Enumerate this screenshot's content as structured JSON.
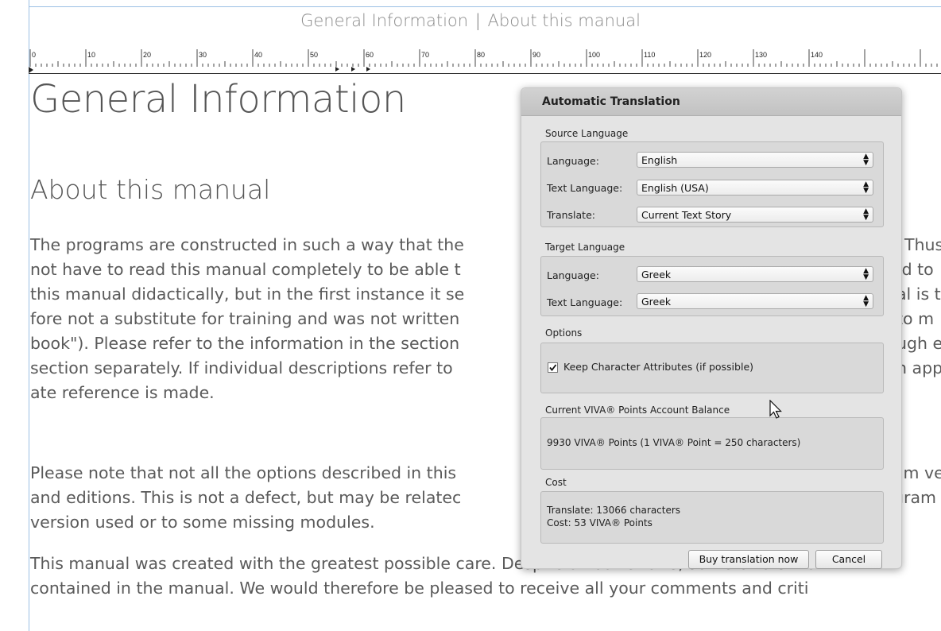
{
  "header": {
    "section": "General Information",
    "separator": "|",
    "topic": "About this manual"
  },
  "ruler": {
    "labels": [
      "0",
      "10",
      "20",
      "30",
      "40",
      "50",
      "60",
      "70",
      "80",
      "90",
      "100",
      "110",
      "120",
      "130",
      "140"
    ]
  },
  "document": {
    "heading1": "General Information",
    "heading2": "About this manual",
    "para1_lines": [
      "The programs are constructed in such a way that the",
      "not have to read this manual completely to be able t",
      "this manual didactically, but in the first instance it se",
      "fore not a substitute for training and was not written",
      "book\"). Please refer to the information in the section",
      "section separately. If individual descriptions refer to",
      "ate reference is made."
    ],
    "para1_right": [
      "Thus",
      "ed to",
      "al is t",
      "to m",
      "ugh e",
      "n app"
    ],
    "para2_lines": [
      "Please note that not all the options described in this",
      "and editions. This is not a defect, but may be relatec",
      "version used or to some missing modules."
    ],
    "para2_right": [
      "am ve",
      "gram"
    ],
    "para3_lines": [
      "This manual was created with the greatest possible care. Despite all our efforts, some errors ma",
      "contained in the manual. We would therefore be pleased to receive all your comments and criti"
    ]
  },
  "dialog": {
    "title": "Automatic Translation",
    "source_section": "Source Language",
    "source": {
      "language_label": "Language:",
      "language_value": "English",
      "text_language_label": "Text Language:",
      "text_language_value": "English (USA)",
      "translate_label": "Translate:",
      "translate_value": "Current Text Story"
    },
    "target_section": "Target Language",
    "target": {
      "language_label": "Language:",
      "language_value": "Greek",
      "text_language_label": "Text Language:",
      "text_language_value": "Greek"
    },
    "options_section": "Options",
    "keep_attributes_label": "Keep Character Attributes (if possible)",
    "keep_attributes_checked": true,
    "balance_section": "Current VIVA® Points Account Balance",
    "balance_text": "9930 VIVA® Points (1 VIVA® Point = 250 characters)",
    "cost_section": "Cost",
    "cost_translate": "Translate: 13066 characters",
    "cost_points": "Cost: 53 VIVA® Points",
    "buy_button": "Buy translation now",
    "cancel_button": "Cancel"
  }
}
